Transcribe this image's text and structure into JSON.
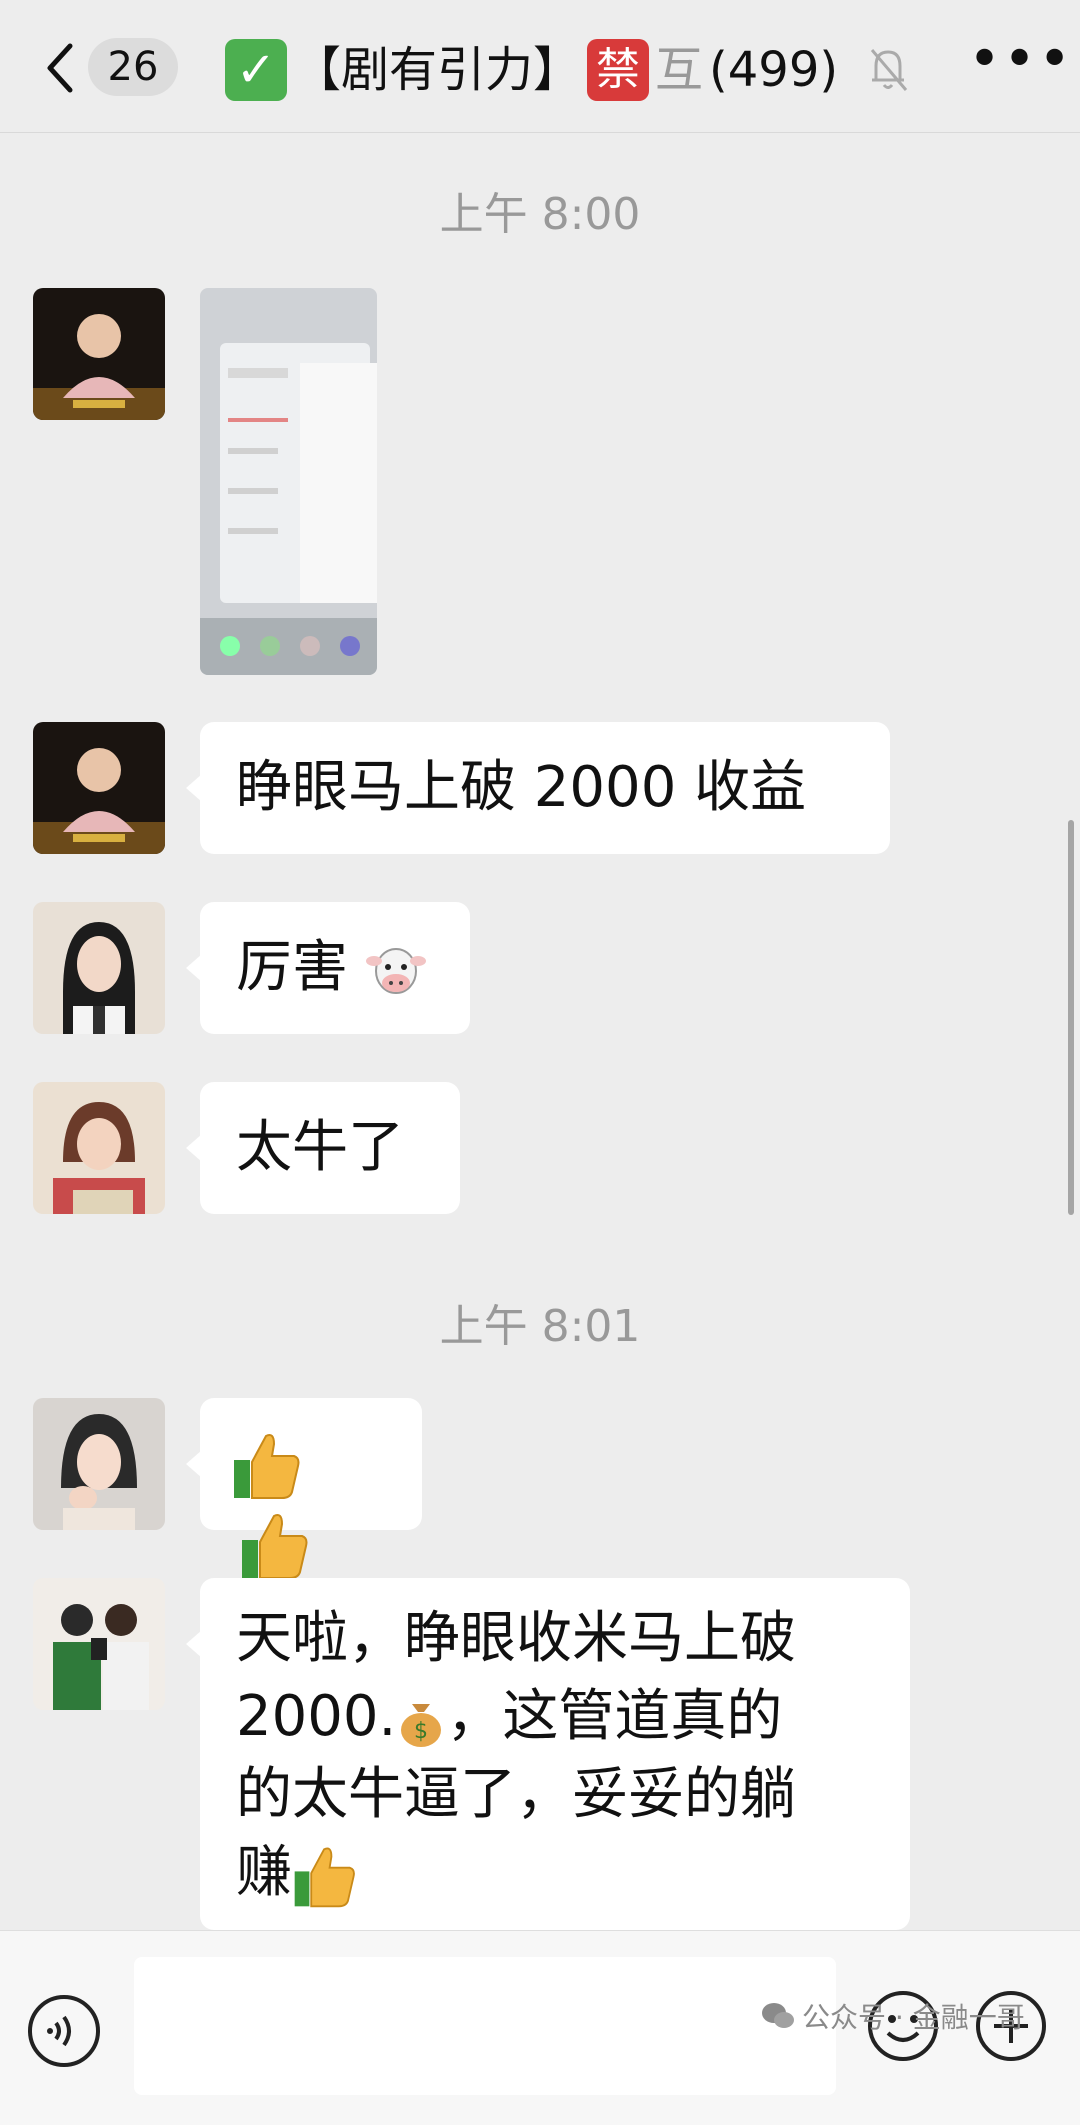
{
  "header": {
    "unread_count": "26",
    "title_prefix": "【剧有引力】",
    "badge_char": "禁",
    "faded_char": "互",
    "member_count": "(499)"
  },
  "messages": {
    "time1": "上午 8:00",
    "msg2": "睁眼马上破 2000 收益",
    "msg3": "厉害",
    "msg4": "太牛了",
    "time2": "上午 8:01",
    "msg6_line1": "天啦，睁眼收米马上破",
    "msg6_line2a": "2000.",
    "msg6_line2b": "，这管道真的",
    "msg6_line3": "的太牛逼了，妥妥的躺",
    "msg6_line4": "赚"
  },
  "icons": [
    "chevron-left-icon",
    "checkmark-icon",
    "mute-bell-icon",
    "more-icon",
    "cow-emoji",
    "thumbs-up-emoji",
    "money-bag-emoji",
    "voice-icon",
    "smile-icon",
    "plus-icon",
    "wechat-icon"
  ],
  "watermark": {
    "text": "公众号 · 金融一哥"
  }
}
